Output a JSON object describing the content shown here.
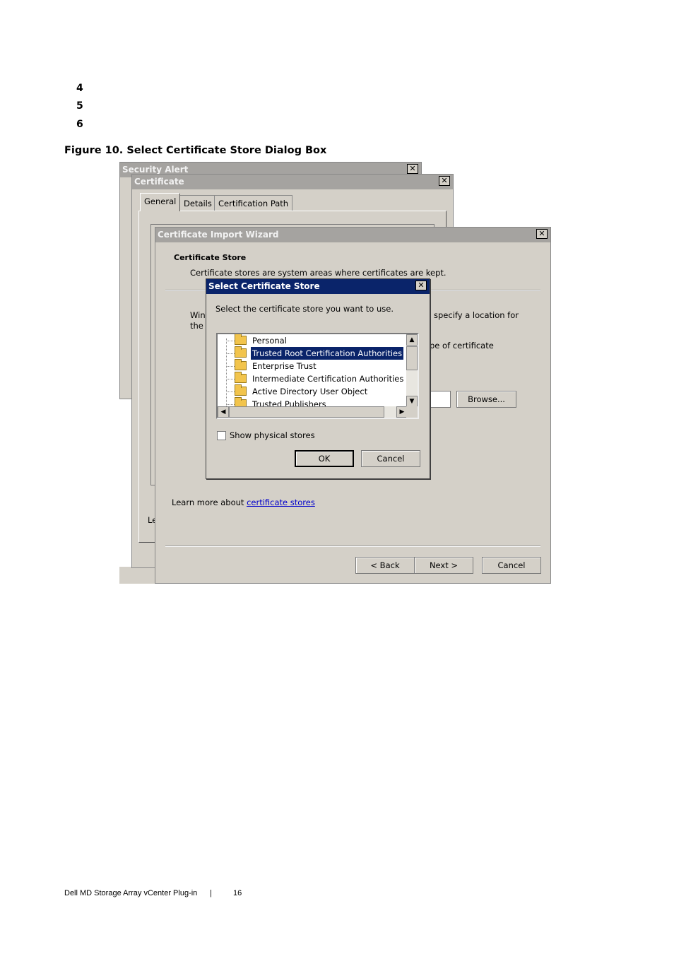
{
  "document": {
    "steps": [
      "4",
      "5",
      "6"
    ],
    "figure_caption": "Figure 10.  Select Certificate Store Dialog Box",
    "footer": {
      "product": "Dell MD Storage Array vCenter Plug-in",
      "separator": "|",
      "page_number": "16"
    }
  },
  "security_alert": {
    "title": "Security Alert",
    "close_glyph": "✕"
  },
  "certificate": {
    "title": "Certificate",
    "close_glyph": "✕",
    "tabs": [
      "General",
      "Details",
      "Certification Path"
    ],
    "active_tab": "General",
    "partial_text": "Le"
  },
  "import_wizard": {
    "title": "Certificate Import Wizard",
    "close_glyph": "✕",
    "heading": "Certificate Store",
    "description": "Certificate stores are system areas where certificates are kept.",
    "partial_left_1": "Win",
    "partial_left_2": "the",
    "partial_right_1": "specify a location for",
    "partial_right_2": "pe of certificate",
    "browse_label": "Browse...",
    "learn_more_prefix": "Learn more about ",
    "learn_more_link": "certificate stores",
    "buttons": {
      "back": "< Back",
      "next": "Next >",
      "cancel": "Cancel"
    }
  },
  "select_store": {
    "title": "Select Certificate Store",
    "close_glyph": "✕",
    "prompt": "Select the certificate store you want to use.",
    "stores": [
      "Personal",
      "Trusted Root Certification Authorities",
      "Enterprise Trust",
      "Intermediate Certification Authorities",
      "Active Directory User Object",
      "Trusted Publishers"
    ],
    "selected_store": "Trusted Root Certification Authorities",
    "show_physical_label": "Show physical stores",
    "show_physical_checked": false,
    "ok_label": "OK",
    "cancel_label": "Cancel"
  }
}
